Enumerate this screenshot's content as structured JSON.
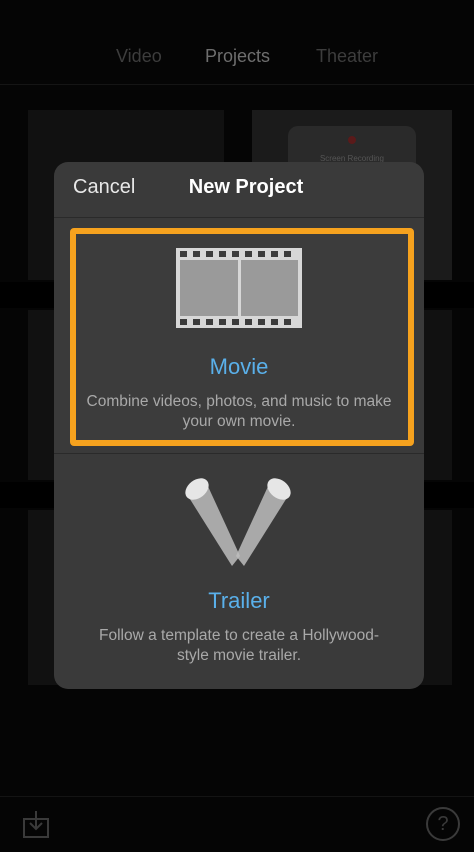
{
  "status_bar": {
    "carrier": "",
    "time": "",
    "battery": ""
  },
  "tabs": [
    {
      "label": "Video",
      "active": false
    },
    {
      "label": "Projects",
      "active": true
    },
    {
      "label": "Theater",
      "active": false
    }
  ],
  "background": {
    "thumbnail_caption": "Screen Recording"
  },
  "modal": {
    "cancel_label": "Cancel",
    "title": "New Project",
    "options": [
      {
        "title": "Movie",
        "description": "Combine videos, photos, and music to make your own movie.",
        "icon": "film-strip-icon",
        "highlighted": true
      },
      {
        "title": "Trailer",
        "description": "Follow a template to create a Hollywood-style movie trailer.",
        "icon": "spotlights-icon",
        "highlighted": false
      }
    ]
  },
  "toolbar": {
    "import_icon": "import-icon",
    "help_label": "?"
  },
  "colors": {
    "accent_highlight": "#f6a21e",
    "option_title": "#5ab0ea",
    "modal_background": "#3a3a3a"
  }
}
